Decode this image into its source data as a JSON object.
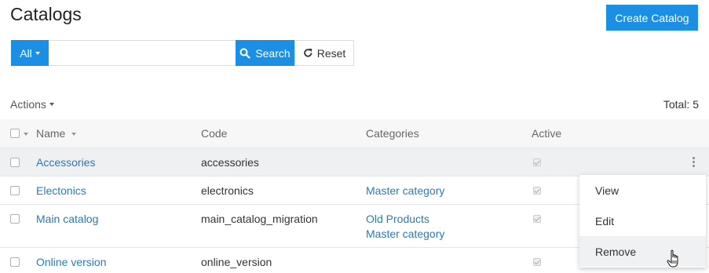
{
  "header": {
    "title": "Catalogs",
    "create_label": "Create Catalog"
  },
  "search": {
    "filter_label": "All",
    "placeholder": "",
    "value": "",
    "search_label": "Search",
    "reset_label": "Reset"
  },
  "toolbar": {
    "actions_label": "Actions",
    "total_label": "Total: 5"
  },
  "table": {
    "columns": {
      "name": "Name",
      "code": "Code",
      "categories": "Categories",
      "active": "Active"
    },
    "rows": [
      {
        "name": "Accessories",
        "code": "accessories",
        "categories": [
          "",
          ""
        ],
        "active": true
      },
      {
        "name": "Electonics",
        "code": "electronics",
        "categories": [
          "Master category",
          ""
        ],
        "active": true
      },
      {
        "name": "Main catalog",
        "code": "main_catalog_migration",
        "categories": [
          "Old Products",
          "Master category"
        ],
        "active": true
      },
      {
        "name": "Online version",
        "code": "online_version",
        "categories": [
          "",
          ""
        ],
        "active": true
      }
    ]
  },
  "row_menu": {
    "items": [
      "View",
      "Edit",
      "Remove"
    ],
    "highlighted": "Remove"
  },
  "colors": {
    "primary": "#1a8fe3",
    "link": "#2a7ab8",
    "hover_row": "#eef0f2"
  }
}
